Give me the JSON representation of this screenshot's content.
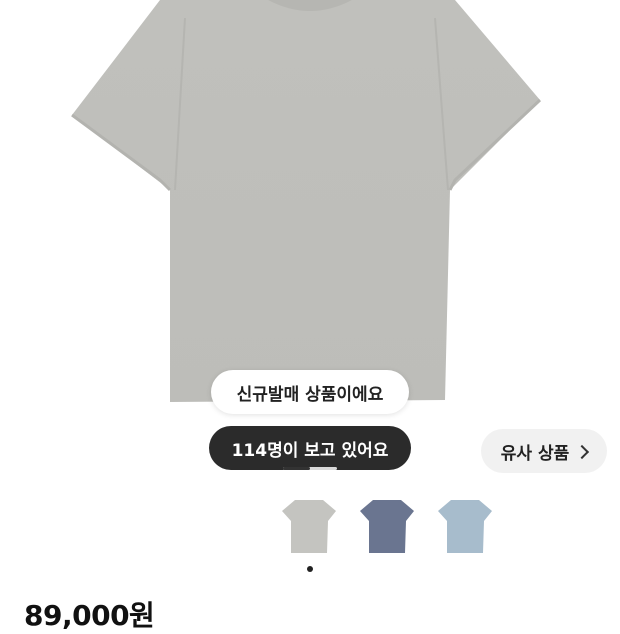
{
  "product": {
    "badge_new": "신규발매 상품이에요",
    "viewers_text": "114명이 보고 있어요",
    "similar_label": "유사 상품",
    "price": "89,000원",
    "gallery_progress": 0.5,
    "colors": [
      {
        "name": "light-gray",
        "hex": "#c4c4c0"
      },
      {
        "name": "washed-navy",
        "hex": "#6a7590"
      },
      {
        "name": "sky-blue",
        "hex": "#a7bccc"
      }
    ],
    "selected_color_index": 0
  }
}
